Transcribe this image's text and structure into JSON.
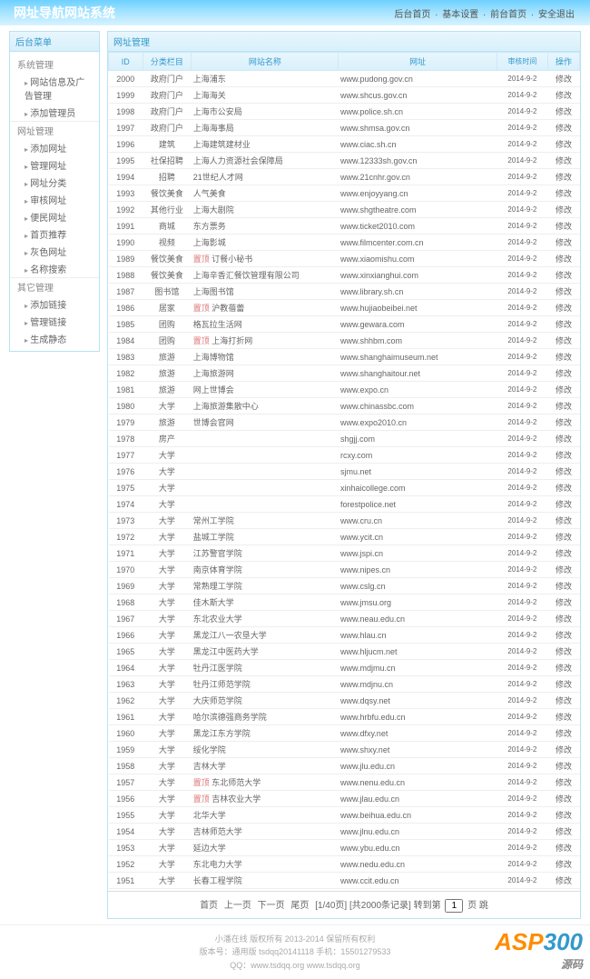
{
  "header": {
    "title": "网址导航网站系统",
    "nav": [
      "后台首页",
      "基本设置",
      "前台首页",
      "安全退出"
    ]
  },
  "sidebar": {
    "title": "后台菜单",
    "groups": [
      {
        "title": "系统管理",
        "items": [
          "网站信息及广告管理",
          "添加管理员"
        ]
      },
      {
        "title": "网址管理",
        "items": [
          "添加网址",
          "管理网址",
          "网址分类",
          "审核网址",
          "便民网址",
          "首页推荐",
          "灰色网址",
          "名称搜索"
        ]
      },
      {
        "title": "其它管理",
        "items": [
          "添加链接",
          "管理链接",
          "生成静态"
        ]
      }
    ]
  },
  "main": {
    "title": "网址管理",
    "columns": [
      "ID",
      "分类栏目",
      "网站名称",
      "网址",
      "审核时间",
      "操作"
    ],
    "op_label": "修改",
    "time": "2014-9-2",
    "rows": [
      {
        "id": "2000",
        "cat": "政府门户",
        "name": "上海浦东",
        "url": "www.pudong.gov.cn"
      },
      {
        "id": "1999",
        "cat": "政府门户",
        "name": "上海海关",
        "url": "www.shcus.gov.cn"
      },
      {
        "id": "1998",
        "cat": "政府门户",
        "name": "上海市公安局",
        "url": "www.police.sh.cn"
      },
      {
        "id": "1997",
        "cat": "政府门户",
        "name": "上海海事局",
        "url": "www.shmsa.gov.cn"
      },
      {
        "id": "1996",
        "cat": "建筑",
        "name": "上海建筑建材业",
        "url": "www.ciac.sh.cn"
      },
      {
        "id": "1995",
        "cat": "社保招聘",
        "name": "上海人力资源社会保障局",
        "url": "www.12333sh.gov.cn"
      },
      {
        "id": "1994",
        "cat": "招聘",
        "name": "21世纪人才网",
        "url": "www.21cnhr.gov.cn"
      },
      {
        "id": "1993",
        "cat": "餐饮美食",
        "name": "人气美食",
        "url": "www.enjoyyang.cn"
      },
      {
        "id": "1992",
        "cat": "其他行业",
        "name": "上海大剧院",
        "url": "www.shgtheatre.com"
      },
      {
        "id": "1991",
        "cat": "商城",
        "name": "东方票务",
        "url": "www.ticket2010.com"
      },
      {
        "id": "1990",
        "cat": "视频",
        "name": "上海影城",
        "url": "www.filmcenter.com.cn"
      },
      {
        "id": "1989",
        "cat": "餐饮美食",
        "hl": true,
        "hlt": "置顶",
        "name": "订餐小秘书",
        "url": "www.xiaomishu.com"
      },
      {
        "id": "1988",
        "cat": "餐饮美食",
        "name": "上海辛香汇餐饮管理有限公司",
        "url": "www.xinxianghui.com"
      },
      {
        "id": "1987",
        "cat": "图书馆",
        "name": "上海图书馆",
        "url": "www.library.sh.cn"
      },
      {
        "id": "1986",
        "cat": "居家",
        "hl": true,
        "hlt": "置顶",
        "name": "沪教蓓蕾",
        "url": "www.hujiaobeibei.net"
      },
      {
        "id": "1985",
        "cat": "团购",
        "name": "格瓦拉生活网",
        "url": "www.gewara.com"
      },
      {
        "id": "1984",
        "cat": "团购",
        "hl": true,
        "hlt": "置顶",
        "name": "上海打折网",
        "url": "www.shhbm.com"
      },
      {
        "id": "1983",
        "cat": "旅游",
        "name": "上海博物馆",
        "url": "www.shanghaimuseum.net"
      },
      {
        "id": "1982",
        "cat": "旅游",
        "name": "上海旅游网",
        "url": "www.shanghaitour.net"
      },
      {
        "id": "1981",
        "cat": "旅游",
        "name": "网上世博会",
        "url": "www.expo.cn"
      },
      {
        "id": "1980",
        "cat": "大学",
        "name": "上海旅游集散中心",
        "url": "www.chinassbc.com"
      },
      {
        "id": "1979",
        "cat": "旅游",
        "name": "世博会官网",
        "url": "www.expo2010.cn"
      },
      {
        "id": "1978",
        "cat": "房产",
        "name": "",
        "url": "shgjj.com"
      },
      {
        "id": "1977",
        "cat": "大学",
        "name": "",
        "url": "rcxy.com"
      },
      {
        "id": "1976",
        "cat": "大学",
        "name": "",
        "url": "sjmu.net"
      },
      {
        "id": "1975",
        "cat": "大学",
        "name": "",
        "url": "xinhaicollege.com"
      },
      {
        "id": "1974",
        "cat": "大学",
        "name": "",
        "url": "forestpolice.net"
      },
      {
        "id": "1973",
        "cat": "大学",
        "name": "常州工学院",
        "url": "www.cru.cn"
      },
      {
        "id": "1972",
        "cat": "大学",
        "name": "盐城工学院",
        "url": "www.ycit.cn"
      },
      {
        "id": "1971",
        "cat": "大学",
        "name": "江苏警官学院",
        "url": "www.jspi.cn"
      },
      {
        "id": "1970",
        "cat": "大学",
        "name": "南京体育学院",
        "url": "www.nipes.cn"
      },
      {
        "id": "1969",
        "cat": "大学",
        "name": "常熟理工学院",
        "url": "www.cslg.cn"
      },
      {
        "id": "1968",
        "cat": "大学",
        "name": "佳木斯大学",
        "url": "www.jmsu.org"
      },
      {
        "id": "1967",
        "cat": "大学",
        "name": "东北农业大学",
        "url": "www.neau.edu.cn"
      },
      {
        "id": "1966",
        "cat": "大学",
        "name": "黑龙江八一农垦大学",
        "url": "www.hlau.cn"
      },
      {
        "id": "1965",
        "cat": "大学",
        "name": "黑龙江中医药大学",
        "url": "www.hljucm.net"
      },
      {
        "id": "1964",
        "cat": "大学",
        "name": "牡丹江医学院",
        "url": "www.mdjmu.cn"
      },
      {
        "id": "1963",
        "cat": "大学",
        "name": "牡丹江师范学院",
        "url": "www.mdjnu.cn"
      },
      {
        "id": "1962",
        "cat": "大学",
        "name": "大庆师范学院",
        "url": "www.dqsy.net"
      },
      {
        "id": "1961",
        "cat": "大学",
        "name": "哈尔滨德强商务学院",
        "url": "www.hrbfu.edu.cn"
      },
      {
        "id": "1960",
        "cat": "大学",
        "name": "黑龙江东方学院",
        "url": "www.dfxy.net"
      },
      {
        "id": "1959",
        "cat": "大学",
        "name": "绥化学院",
        "url": "www.shxy.net"
      },
      {
        "id": "1958",
        "cat": "大学",
        "name": "吉林大学",
        "url": "www.jlu.edu.cn"
      },
      {
        "id": "1957",
        "cat": "大学",
        "hl": true,
        "hlt": "置顶",
        "name": "东北师范大学",
        "url": "www.nenu.edu.cn"
      },
      {
        "id": "1956",
        "cat": "大学",
        "hl": true,
        "hlt": "置顶",
        "name": "吉林农业大学",
        "url": "www.jlau.edu.cn"
      },
      {
        "id": "1955",
        "cat": "大学",
        "name": "北华大学",
        "url": "www.beihua.edu.cn"
      },
      {
        "id": "1954",
        "cat": "大学",
        "name": "吉林师范大学",
        "url": "www.jlnu.edu.cn"
      },
      {
        "id": "1953",
        "cat": "大学",
        "name": "延边大学",
        "url": "www.ybu.edu.cn"
      },
      {
        "id": "1952",
        "cat": "大学",
        "name": "东北电力大学",
        "url": "www.nedu.edu.cn"
      },
      {
        "id": "1951",
        "cat": "大学",
        "name": "长春工程学院",
        "url": "www.ccit.edu.cn"
      }
    ],
    "pager": {
      "first": "首页",
      "prev": "上一页",
      "next": "下一页",
      "last": "尾页",
      "info": "[1/40页] [共2000条记录] 转到第",
      "page": "1",
      "btn": "页 跳"
    }
  },
  "footer": {
    "line1": "小潘在线 版权所有 2013-2014 保留所有权利",
    "line2": "版本号：通用版 tsdqq20141118  手机：15501279533",
    "line3": "QQ：www.tsdqq.org  www.tsdqq.org"
  },
  "logo": {
    "a": "ASP",
    "b": "300",
    "c": "源码"
  }
}
